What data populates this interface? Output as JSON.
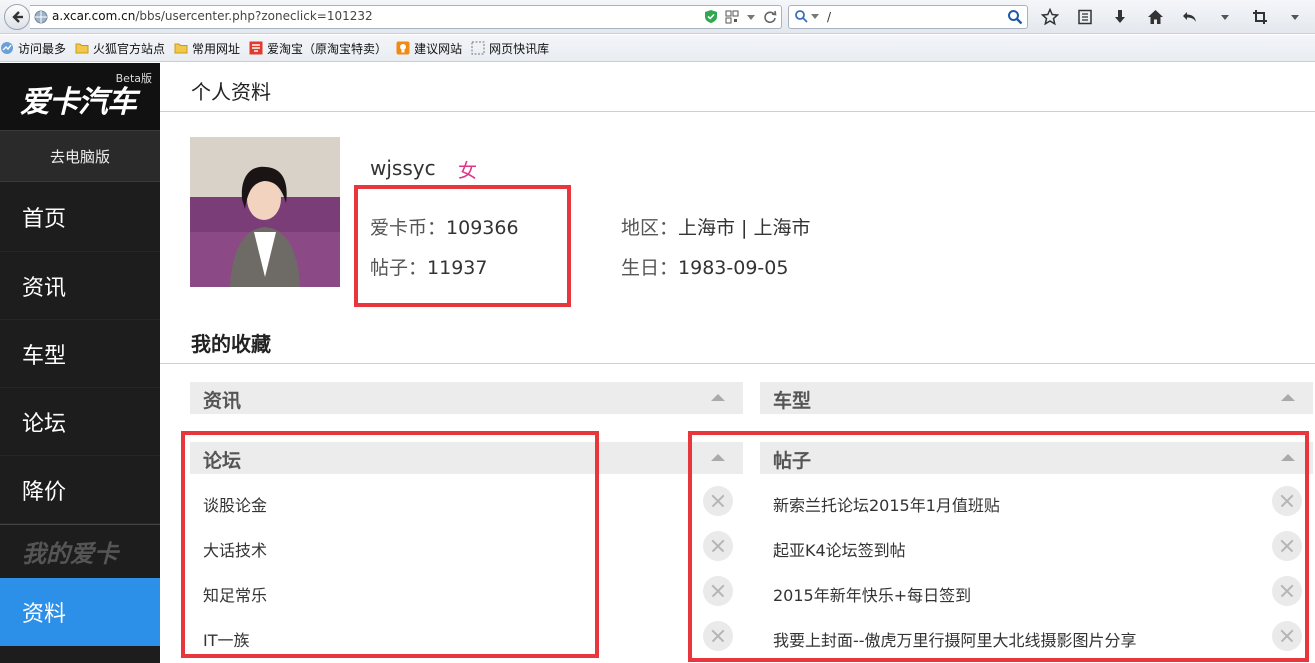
{
  "browser": {
    "url_host": "a.xcar.com.cn",
    "url_path": "/bbs/usercenter.php?zoneclick=101232",
    "search_value": "/",
    "bookmarks": [
      {
        "label": "访问最多"
      },
      {
        "label": "火狐官方站点"
      },
      {
        "label": "常用网址"
      },
      {
        "label": "爱淘宝（原淘宝特卖）"
      },
      {
        "label": "建议网站"
      },
      {
        "label": "网页快讯库"
      }
    ]
  },
  "sidebar": {
    "logo": "爱卡汽车",
    "beta": "Beta版",
    "pc_link": "去电脑版",
    "items": [
      {
        "label": "首页"
      },
      {
        "label": "资讯"
      },
      {
        "label": "车型"
      },
      {
        "label": "论坛"
      },
      {
        "label": "降价"
      }
    ],
    "my_section": "我的爱卡",
    "active": "资料"
  },
  "profile": {
    "page_title": "个人资料",
    "username": "wjssyc",
    "gender": "女",
    "coins_label": "爱卡币：",
    "coins": "109366",
    "posts_label": "帖子：",
    "posts": "11937",
    "region_label": "地区：",
    "region": "上海市 | 上海市",
    "birthday_label": "生日：",
    "birthday": "1983-09-05"
  },
  "favorites": {
    "title": "我的收藏",
    "sections": {
      "news": "资讯",
      "models": "车型",
      "forum": "论坛",
      "posts": "帖子"
    },
    "forum_items": [
      "谈股论金",
      "大话技术",
      "知足常乐",
      "IT一族"
    ],
    "post_items": [
      "新索兰托论坛2015年1月值班贴",
      "起亚K4论坛签到帖",
      "2015年新年快乐+每日签到",
      "我要上封面--傲虎万里行摄阿里大北线摄影图片分享"
    ]
  },
  "colors": {
    "accent": "#2c8fe8",
    "highlight": "#e8373c",
    "gender": "#e0338a"
  }
}
